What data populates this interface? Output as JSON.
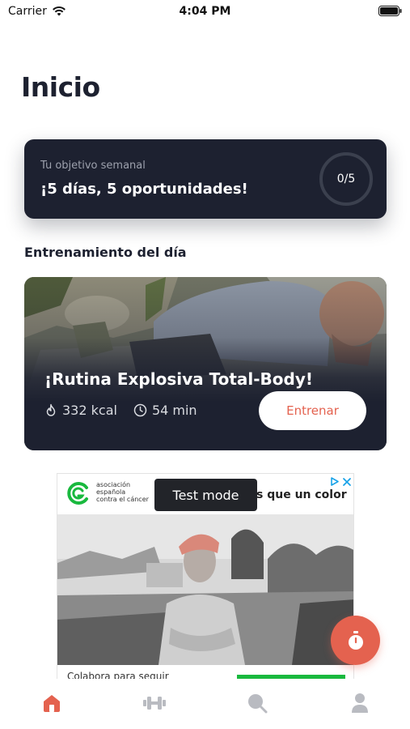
{
  "status_bar": {
    "carrier": "Carrier",
    "time": "4:04 PM",
    "icons": [
      "wifi-icon",
      "battery-icon"
    ]
  },
  "page": {
    "title": "Inicio"
  },
  "weekly_goal": {
    "caption": "Tu objetivo semanal",
    "message": "¡5 días, 5 oportunidades!",
    "progress_label": "0/5",
    "completed": 0,
    "target": 5
  },
  "daily_workout": {
    "section_title": "Entrenamiento del día",
    "title": "¡Rutina Explosiva Total-Body!",
    "calories": "332 kcal",
    "duration": "54 min",
    "cta_label": "Entrenar",
    "icons": [
      "flame-icon",
      "clock-icon"
    ]
  },
  "ad": {
    "brand_lines": [
      "asociación",
      "española",
      "contra el cáncer"
    ],
    "headline": "s que un color",
    "footer_text": "Colabora para seguir",
    "test_badge": "Test mode",
    "icons": [
      "ad-choices-icon",
      "close-icon"
    ]
  },
  "fab": {
    "icon": "stopwatch-icon"
  },
  "tab_bar": {
    "tabs": [
      {
        "icon": "home-icon",
        "active": true
      },
      {
        "icon": "dumbbell-icon",
        "active": false
      },
      {
        "icon": "search-icon",
        "active": false
      },
      {
        "icon": "profile-icon",
        "active": false
      }
    ]
  },
  "colors": {
    "dark": "#1d2130",
    "accent": "#e4624f",
    "tab_inactive": "#b9bbc1",
    "ad_green": "#19b93e"
  }
}
